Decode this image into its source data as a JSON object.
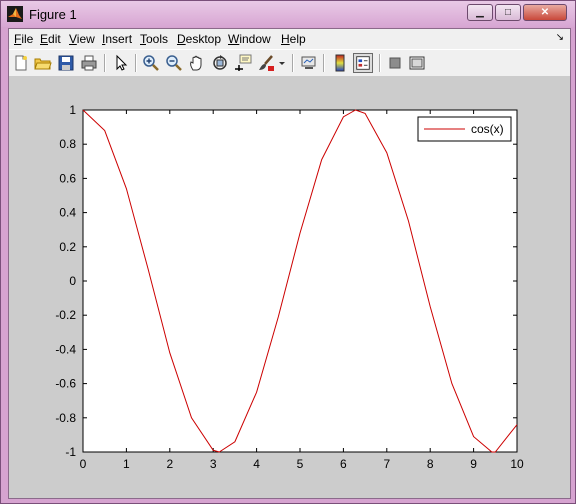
{
  "window": {
    "title": "Figure 1",
    "controls": {
      "minimize": "▁",
      "maximize": "□",
      "close": "✕"
    }
  },
  "menu": [
    {
      "label": "File"
    },
    {
      "label": "Edit"
    },
    {
      "label": "View"
    },
    {
      "label": "Insert"
    },
    {
      "label": "Tools"
    },
    {
      "label": "Desktop"
    },
    {
      "label": "Window"
    },
    {
      "label": "Help"
    }
  ],
  "toolbar": [
    "new-figure-icon",
    "open-file-icon",
    "save-icon",
    "print-icon",
    "edit-plot-arrow-icon",
    "zoom-in-icon",
    "zoom-out-icon",
    "pan-hand-icon",
    "rotate-3d-icon",
    "data-cursor-icon",
    "brush-icon",
    "dropdown-arrow-icon",
    "link-plot-icon",
    "colorbar-icon",
    "legend-icon",
    "hide-plot-tools-icon",
    "show-plot-tools-icon"
  ],
  "colors": {
    "line": "#cc0000",
    "figure_bg": "#cccccc",
    "axes_bg": "#ffffff"
  },
  "chart_data": {
    "type": "line",
    "title": "",
    "xlabel": "",
    "ylabel": "",
    "xlim": [
      0,
      10
    ],
    "ylim": [
      -1,
      1
    ],
    "xticks": [
      "0",
      "1",
      "2",
      "3",
      "4",
      "5",
      "6",
      "7",
      "8",
      "9",
      "10"
    ],
    "yticks": [
      "-1",
      "-0.8",
      "-0.6",
      "-0.4",
      "-0.2",
      "0",
      "0.2",
      "0.4",
      "0.6",
      "0.8",
      "1"
    ],
    "grid": false,
    "legend_position": "top-right",
    "series": [
      {
        "name": "cos(x)",
        "color": "#cc0000",
        "x": [
          0,
          0.5,
          1,
          1.5,
          2,
          2.5,
          3,
          3.14,
          3.5,
          4,
          4.5,
          5,
          5.5,
          6,
          6.28,
          6.5,
          7,
          7.5,
          8,
          8.5,
          9,
          9.42,
          9.5,
          10
        ],
        "y": [
          1,
          0.88,
          0.54,
          0.07,
          -0.42,
          -0.8,
          -0.99,
          -1,
          -0.94,
          -0.65,
          -0.21,
          0.28,
          0.71,
          0.96,
          1,
          0.98,
          0.75,
          0.35,
          -0.15,
          -0.6,
          -0.91,
          -1,
          -1,
          -0.84
        ]
      }
    ]
  }
}
